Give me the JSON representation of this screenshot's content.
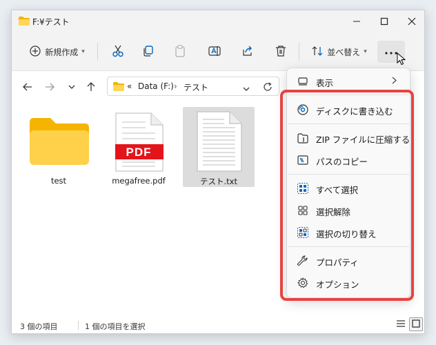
{
  "window": {
    "title": "F:¥テスト"
  },
  "toolbar": {
    "new_label": "新規作成",
    "sort_label": "並べ替え",
    "more_label": "…"
  },
  "address": {
    "overflow": "«",
    "crumbs": [
      "Data (F:)",
      "テスト"
    ],
    "separator": "›"
  },
  "files": [
    {
      "name": "test",
      "type": "folder"
    },
    {
      "name": "megafree.pdf",
      "type": "pdf",
      "badge": "PDF"
    },
    {
      "name": "テスト.txt",
      "type": "text",
      "selected": true
    }
  ],
  "status": {
    "count": "3 個の項目",
    "selection": "1 個の項目を選択"
  },
  "menu": {
    "items": [
      {
        "label": "表示",
        "icon": "view-icon",
        "submenu": true
      },
      {
        "label": "ディスクに書き込む",
        "icon": "disc-burn-icon"
      },
      {
        "label": "ZIP ファイルに圧縮する",
        "icon": "zip-icon"
      },
      {
        "label": "パスのコピー",
        "icon": "copy-path-icon"
      },
      {
        "label": "すべて選択",
        "icon": "select-all-icon"
      },
      {
        "label": "選択解除",
        "icon": "select-none-icon"
      },
      {
        "label": "選択の切り替え",
        "icon": "invert-selection-icon"
      },
      {
        "label": "プロパティ",
        "icon": "wrench-icon"
      },
      {
        "label": "オプション",
        "icon": "gear-icon"
      }
    ]
  },
  "colors": {
    "highlight": "#e8433f",
    "accent": "#0067c0",
    "folder": "#f7c948"
  }
}
